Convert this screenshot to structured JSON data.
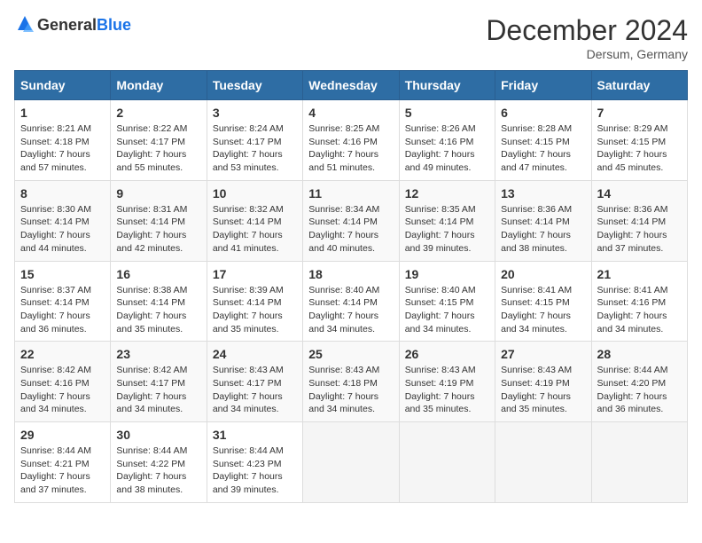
{
  "logo": {
    "general": "General",
    "blue": "Blue"
  },
  "title": "December 2024",
  "location": "Dersum, Germany",
  "headers": [
    "Sunday",
    "Monday",
    "Tuesday",
    "Wednesday",
    "Thursday",
    "Friday",
    "Saturday"
  ],
  "weeks": [
    [
      {
        "day": "1",
        "sunrise": "Sunrise: 8:21 AM",
        "sunset": "Sunset: 4:18 PM",
        "daylight": "Daylight: 7 hours and 57 minutes."
      },
      {
        "day": "2",
        "sunrise": "Sunrise: 8:22 AM",
        "sunset": "Sunset: 4:17 PM",
        "daylight": "Daylight: 7 hours and 55 minutes."
      },
      {
        "day": "3",
        "sunrise": "Sunrise: 8:24 AM",
        "sunset": "Sunset: 4:17 PM",
        "daylight": "Daylight: 7 hours and 53 minutes."
      },
      {
        "day": "4",
        "sunrise": "Sunrise: 8:25 AM",
        "sunset": "Sunset: 4:16 PM",
        "daylight": "Daylight: 7 hours and 51 minutes."
      },
      {
        "day": "5",
        "sunrise": "Sunrise: 8:26 AM",
        "sunset": "Sunset: 4:16 PM",
        "daylight": "Daylight: 7 hours and 49 minutes."
      },
      {
        "day": "6",
        "sunrise": "Sunrise: 8:28 AM",
        "sunset": "Sunset: 4:15 PM",
        "daylight": "Daylight: 7 hours and 47 minutes."
      },
      {
        "day": "7",
        "sunrise": "Sunrise: 8:29 AM",
        "sunset": "Sunset: 4:15 PM",
        "daylight": "Daylight: 7 hours and 45 minutes."
      }
    ],
    [
      {
        "day": "8",
        "sunrise": "Sunrise: 8:30 AM",
        "sunset": "Sunset: 4:14 PM",
        "daylight": "Daylight: 7 hours and 44 minutes."
      },
      {
        "day": "9",
        "sunrise": "Sunrise: 8:31 AM",
        "sunset": "Sunset: 4:14 PM",
        "daylight": "Daylight: 7 hours and 42 minutes."
      },
      {
        "day": "10",
        "sunrise": "Sunrise: 8:32 AM",
        "sunset": "Sunset: 4:14 PM",
        "daylight": "Daylight: 7 hours and 41 minutes."
      },
      {
        "day": "11",
        "sunrise": "Sunrise: 8:34 AM",
        "sunset": "Sunset: 4:14 PM",
        "daylight": "Daylight: 7 hours and 40 minutes."
      },
      {
        "day": "12",
        "sunrise": "Sunrise: 8:35 AM",
        "sunset": "Sunset: 4:14 PM",
        "daylight": "Daylight: 7 hours and 39 minutes."
      },
      {
        "day": "13",
        "sunrise": "Sunrise: 8:36 AM",
        "sunset": "Sunset: 4:14 PM",
        "daylight": "Daylight: 7 hours and 38 minutes."
      },
      {
        "day": "14",
        "sunrise": "Sunrise: 8:36 AM",
        "sunset": "Sunset: 4:14 PM",
        "daylight": "Daylight: 7 hours and 37 minutes."
      }
    ],
    [
      {
        "day": "15",
        "sunrise": "Sunrise: 8:37 AM",
        "sunset": "Sunset: 4:14 PM",
        "daylight": "Daylight: 7 hours and 36 minutes."
      },
      {
        "day": "16",
        "sunrise": "Sunrise: 8:38 AM",
        "sunset": "Sunset: 4:14 PM",
        "daylight": "Daylight: 7 hours and 35 minutes."
      },
      {
        "day": "17",
        "sunrise": "Sunrise: 8:39 AM",
        "sunset": "Sunset: 4:14 PM",
        "daylight": "Daylight: 7 hours and 35 minutes."
      },
      {
        "day": "18",
        "sunrise": "Sunrise: 8:40 AM",
        "sunset": "Sunset: 4:14 PM",
        "daylight": "Daylight: 7 hours and 34 minutes."
      },
      {
        "day": "19",
        "sunrise": "Sunrise: 8:40 AM",
        "sunset": "Sunset: 4:15 PM",
        "daylight": "Daylight: 7 hours and 34 minutes."
      },
      {
        "day": "20",
        "sunrise": "Sunrise: 8:41 AM",
        "sunset": "Sunset: 4:15 PM",
        "daylight": "Daylight: 7 hours and 34 minutes."
      },
      {
        "day": "21",
        "sunrise": "Sunrise: 8:41 AM",
        "sunset": "Sunset: 4:16 PM",
        "daylight": "Daylight: 7 hours and 34 minutes."
      }
    ],
    [
      {
        "day": "22",
        "sunrise": "Sunrise: 8:42 AM",
        "sunset": "Sunset: 4:16 PM",
        "daylight": "Daylight: 7 hours and 34 minutes."
      },
      {
        "day": "23",
        "sunrise": "Sunrise: 8:42 AM",
        "sunset": "Sunset: 4:17 PM",
        "daylight": "Daylight: 7 hours and 34 minutes."
      },
      {
        "day": "24",
        "sunrise": "Sunrise: 8:43 AM",
        "sunset": "Sunset: 4:17 PM",
        "daylight": "Daylight: 7 hours and 34 minutes."
      },
      {
        "day": "25",
        "sunrise": "Sunrise: 8:43 AM",
        "sunset": "Sunset: 4:18 PM",
        "daylight": "Daylight: 7 hours and 34 minutes."
      },
      {
        "day": "26",
        "sunrise": "Sunrise: 8:43 AM",
        "sunset": "Sunset: 4:19 PM",
        "daylight": "Daylight: 7 hours and 35 minutes."
      },
      {
        "day": "27",
        "sunrise": "Sunrise: 8:43 AM",
        "sunset": "Sunset: 4:19 PM",
        "daylight": "Daylight: 7 hours and 35 minutes."
      },
      {
        "day": "28",
        "sunrise": "Sunrise: 8:44 AM",
        "sunset": "Sunset: 4:20 PM",
        "daylight": "Daylight: 7 hours and 36 minutes."
      }
    ],
    [
      {
        "day": "29",
        "sunrise": "Sunrise: 8:44 AM",
        "sunset": "Sunset: 4:21 PM",
        "daylight": "Daylight: 7 hours and 37 minutes."
      },
      {
        "day": "30",
        "sunrise": "Sunrise: 8:44 AM",
        "sunset": "Sunset: 4:22 PM",
        "daylight": "Daylight: 7 hours and 38 minutes."
      },
      {
        "day": "31",
        "sunrise": "Sunrise: 8:44 AM",
        "sunset": "Sunset: 4:23 PM",
        "daylight": "Daylight: 7 hours and 39 minutes."
      },
      null,
      null,
      null,
      null
    ]
  ]
}
